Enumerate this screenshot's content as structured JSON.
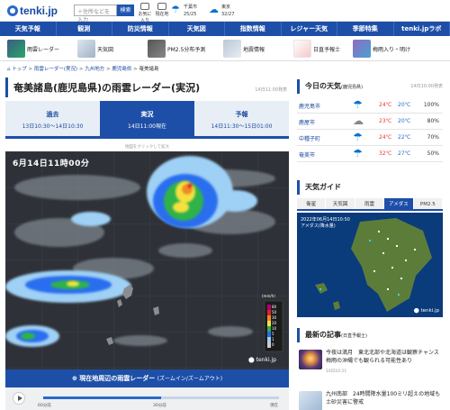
{
  "header": {
    "logo": "tenki.jp",
    "search_placeholder": "＋住所などを入力",
    "search_button": "検索",
    "btn_favorite": "お気に入り",
    "btn_current": "現在地",
    "weather": [
      {
        "city": "千葉市",
        "temps": "25/25"
      },
      {
        "city": "東京",
        "temps": "32/27"
      }
    ]
  },
  "nav": [
    "天気予報",
    "観測",
    "防災情報",
    "天気図",
    "指数情報",
    "レジャー天気",
    "季節特集",
    "tenki.jpラボ"
  ],
  "subnav": [
    "雨雲レーダー",
    "天気図",
    "PM2.5分布予測",
    "地震情報",
    "日直予報士",
    "梅雨入り・明け"
  ],
  "breadcrumb": [
    "トップ",
    "雨雲レーダー(実況)",
    "九州地方",
    "鹿児島県",
    "奄美諸島"
  ],
  "main": {
    "title": "奄美諸島(鹿児島県)の雨雲レーダー(実況)",
    "issued": "14日11:00発表",
    "tabs": [
      {
        "label": "過去",
        "range": "13日10:30〜14日10:30"
      },
      {
        "label": "実況",
        "range": "14日11:00現在"
      },
      {
        "label": "予報",
        "range": "14日11:30〜15日01:00"
      }
    ],
    "map_hint": "地図をクリックして拡大",
    "map_time": "6月14日11時00分",
    "legend_title": "(mm/h)",
    "legend_values": [
      "80",
      "50",
      "30",
      "20",
      "10",
      "5",
      "1",
      "0"
    ],
    "map_logo": "tenki.jp",
    "radar_link": "現在地周辺の雨雲レーダー",
    "radar_link_sub": "(ズームイン/ズームアウト)",
    "timeline_ticks": [
      "60分前",
      "30分前",
      "現在"
    ],
    "timeline_progress_pct": 50
  },
  "sidebar": {
    "today_title": "今日の天気",
    "today_sub": "(鹿児島県)",
    "today_issued": "14日10:00発表",
    "weather_rows": [
      {
        "city": "鹿児島市",
        "hi": "24℃",
        "lo": "20℃",
        "pop": "100%"
      },
      {
        "city": "鹿屋市",
        "hi": "23℃",
        "lo": "20℃",
        "pop": "80%"
      },
      {
        "city": "中種子町",
        "hi": "24℃",
        "lo": "22℃",
        "pop": "70%"
      },
      {
        "city": "奄美市",
        "hi": "32℃",
        "lo": "27℃",
        "pop": "50%"
      }
    ],
    "guide_title": "天気ガイド",
    "guide_tabs": [
      "衛星",
      "天気図",
      "雨雲",
      "アメダス",
      "PM2.5"
    ],
    "guide_active": 3,
    "guide_time": "2022年06月14日10:50",
    "guide_sub": "アメダス(降水量)",
    "guide_logo": "tenki.jp",
    "articles_title": "最新の記事",
    "articles_sub": "(日直予報士)",
    "articles": [
      {
        "text": "今夜は満月　東北北部や北海道は観察チャンス　梅雨の沖縄でも観られる可能性あり",
        "date": "14日10:21"
      },
      {
        "text": "九州南部　24時間降水量100ミリ超えの地域も　土砂災害に警戒",
        "date": ""
      }
    ]
  },
  "colors": {
    "brand": "#1d4fa8",
    "map_bg": "#2e3137",
    "hot": "#e33333",
    "cold": "#2a6ac8"
  }
}
